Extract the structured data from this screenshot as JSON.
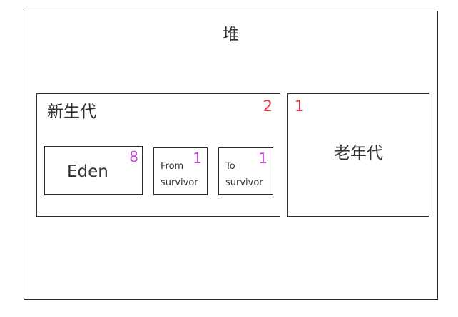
{
  "heap": {
    "title": "堆"
  },
  "young_gen": {
    "title": "新生代",
    "ratio": "2",
    "eden": {
      "title": "Eden",
      "ratio": "8"
    },
    "from_survivor": {
      "line1": "From",
      "line2": "survivor",
      "ratio": "1"
    },
    "to_survivor": {
      "line1": "To",
      "line2": "survivor",
      "ratio": "1"
    }
  },
  "old_gen": {
    "title": "老年代",
    "ratio": "1"
  },
  "colors": {
    "ratio_generation": "#e5323e",
    "ratio_young_space": "#c646d6",
    "border": "#2b2b2b",
    "text": "#333333"
  }
}
